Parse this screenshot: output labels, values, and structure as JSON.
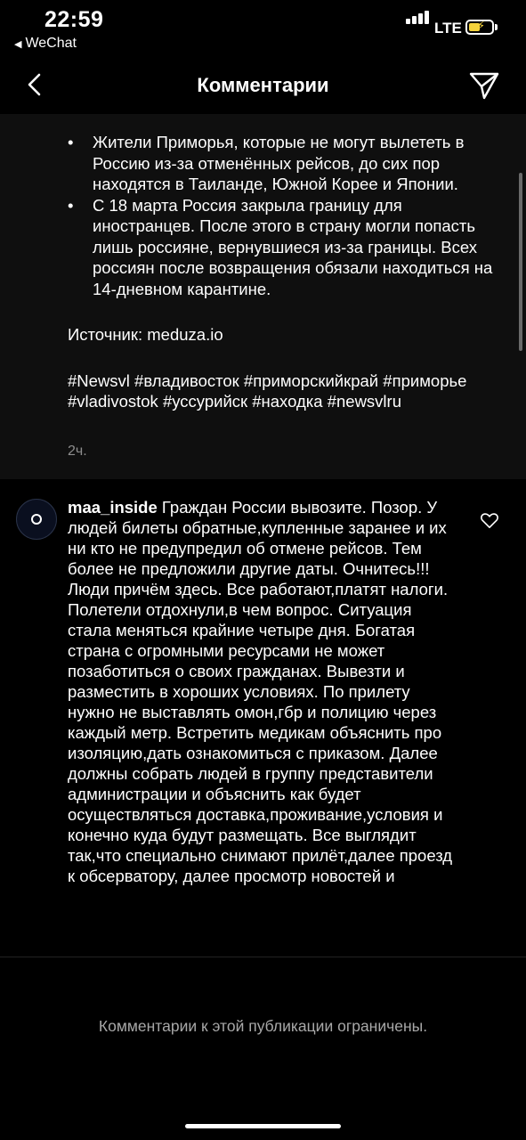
{
  "status_bar": {
    "time": "22:59",
    "back_app": "WeChat",
    "network": "LTE",
    "battery_color": "#f4d23b"
  },
  "nav": {
    "title": "Комментарии",
    "back_icon": "chevron-left-icon",
    "send_icon": "paper-plane-icon"
  },
  "post": {
    "bullets": [
      "Жители Приморья, которые не могут вылететь в Россию из-за отменённых рейсов, до сих пор находятся в Таиланде, Южной Корее и Японии.",
      "С 18 марта Россия закрыла границу для иностранцев. После этого в страну могли попасть лишь россияне, вернувшиеся из-за границы. Всех россиян после возвращения обязали находиться на 14-дневном карантине."
    ],
    "bullet_char": "•",
    "source": "Источник: meduza.io",
    "hashtags": "#Newsvl #владивосток #приморскийкрай #приморье #vladivostok #уссурийск #находка #newsvlru",
    "time_ago": "2ч."
  },
  "comment": {
    "username": "maa_inside",
    "text": "Граждан России вывозите. Позор. У людей билеты обратные,купленные заранее и их ни кто не предупредил об отмене рейсов. Тем более не предложили другие даты. Очнитесь!!! Люди причём здесь. Все работают,платят налоги. Полетели отдохнули,в чем вопрос. Ситуация стала меняться крайние четыре дня. Богатая страна с огромными ресурсами не может позаботиться о своих гражданах. Вывезти и разместить в хороших условиях. По прилету нужно не выставлять омон,гбр и полицию через каждый метр. Встретить медикам объяснить про изоляцию,дать ознакомиться с приказом. Далее должны собрать людей в группу представители администрации и объяснить как будет осуществляться доставка,проживание,условия и конечно куда будут размещать. Все выглядит так,что специально снимают прилёт,далее проезд к обсерватору, далее просмотр новостей и",
    "like_icon": "heart-icon"
  },
  "footer": {
    "message": "Комментарии к этой публикации ограничены."
  }
}
